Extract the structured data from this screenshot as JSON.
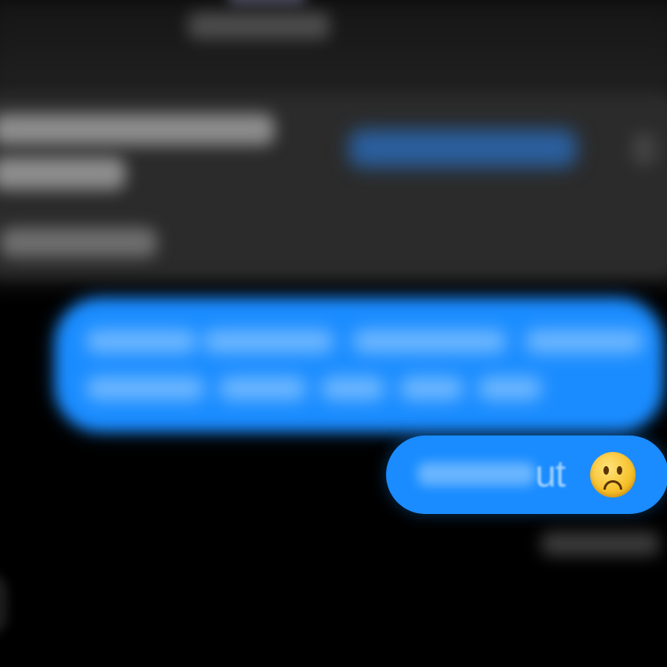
{
  "header": {
    "contact_name": ""
  },
  "preview_card": {
    "title": "",
    "subtitle": "",
    "link_label": ""
  },
  "messages": [
    {
      "sender": "me",
      "text": ""
    },
    {
      "sender": "me",
      "text": "ut",
      "emoji": "🙁"
    }
  ],
  "status": {
    "delivered_label": ""
  },
  "colors": {
    "background": "#000000",
    "bubble_blue": "#1a8cff",
    "card_background": "#2b2b2b",
    "link_blue": "#2a5f9e"
  },
  "icons": {
    "emoji": "slightly-frowning-face-icon"
  }
}
